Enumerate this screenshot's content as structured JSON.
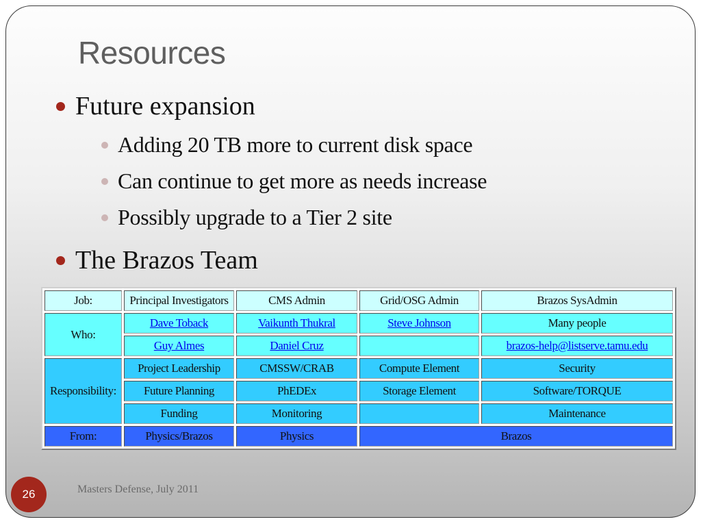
{
  "slide": {
    "title": "Resources",
    "bullets": [
      {
        "text": "Future expansion",
        "children": [
          "Adding 20 TB more to current disk space",
          "Can continue to get more as needs increase",
          "Possibly upgrade to a Tier 2 site"
        ]
      },
      {
        "text": "The Brazos Team"
      }
    ],
    "footer": "Masters Defense, July 2011",
    "page_number": "26",
    "accent_color": "#a3271c"
  },
  "team_table": {
    "row_colors": {
      "job": "#ccffff",
      "who": "#66ffff",
      "responsibility": "#33ccff",
      "from": "#3366ff"
    },
    "job": {
      "label": "Job:",
      "cols": [
        "Principal Investigators",
        "CMS Admin",
        "Grid/OSG Admin",
        "Brazos SysAdmin"
      ]
    },
    "who": {
      "label": "Who:",
      "rows": [
        [
          "Dave Toback",
          "Vaikunth Thukral",
          "Steve Johnson",
          "Many people"
        ],
        [
          "Guy Almes",
          "Daniel Cruz",
          "",
          "brazos-help@listserve.tamu.edu"
        ]
      ]
    },
    "responsibility": {
      "label": "Responsibility:",
      "rows": [
        [
          "Project Leadership",
          "CMSSW/CRAB",
          "Compute Element",
          "Security"
        ],
        [
          "Future Planning",
          "PhEDEx",
          "Storage Element",
          "Software/TORQUE"
        ],
        [
          "Funding",
          "Monitoring",
          "",
          "Maintenance"
        ]
      ]
    },
    "from": {
      "label": "From:",
      "cols": [
        "Physics/Brazos",
        "Physics",
        "Brazos"
      ]
    }
  }
}
